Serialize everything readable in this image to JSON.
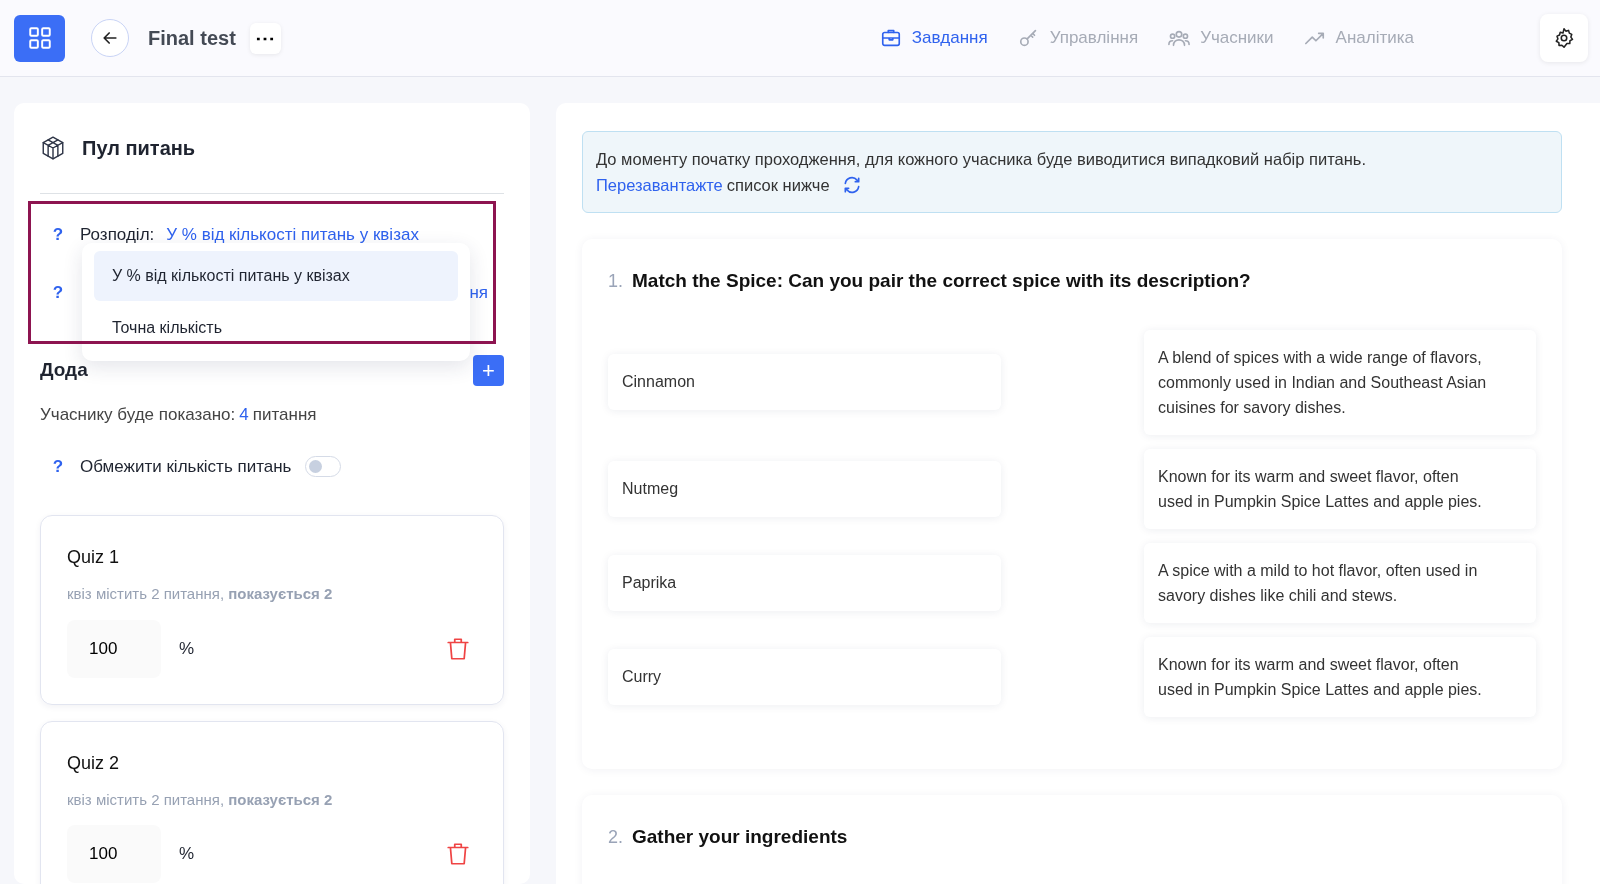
{
  "header": {
    "title": "Final test",
    "more_button": "⋯",
    "nav": [
      {
        "label": "Завдання",
        "selected": true
      },
      {
        "label": "Управління",
        "selected": false
      },
      {
        "label": "Учасники",
        "selected": false
      },
      {
        "label": "Аналітика",
        "selected": false
      }
    ]
  },
  "pool": {
    "title": "Пул питань",
    "distribution": {
      "help": "?",
      "label": "Розподіл:",
      "value": "У % від кількості питань у квізах"
    },
    "second_row": {
      "help": "?",
      "value": "ня"
    },
    "dropdown": {
      "options": [
        {
          "label": "У % від кількості питань у квізах",
          "selected": true
        },
        {
          "label": "Точна кількість",
          "selected": false
        }
      ]
    },
    "quizzes_heading": "Дода",
    "add_button": "+",
    "shown": {
      "prefix": "Учаснику буде показано:",
      "count": "4",
      "suffix": "питання"
    },
    "limit": {
      "help": "?",
      "label": "Обмежити кількість питань",
      "on": false
    },
    "quizzes": [
      {
        "title": "Quiz 1",
        "info": "квіз містить 2 питання, **показується 2**",
        "value": "100",
        "unit": "%"
      },
      {
        "title": "Quiz 2",
        "info": "квіз містить 2 питання, **показується 2**",
        "value": "100",
        "unit": "%"
      }
    ]
  },
  "info_alert": {
    "text": "До моменту початку проходження, для кожного учасника буде виводитися випадковий набір питань.",
    "link": "Перезавантажте",
    "after": "список нижче"
  },
  "questions": [
    {
      "number": "1.",
      "title": "Match the Spice: Can you pair the correct spice with its description?",
      "pairs": [
        {
          "left": "Cinnamon",
          "right": "A blend of spices with a wide range of flavors, commonly used in Indian and Southeast Asian cuisines for savory dishes."
        },
        {
          "left": "Nutmeg",
          "right": "Known for its warm and sweet flavor, often used in Pumpkin Spice Lattes and apple pies."
        },
        {
          "left": "Paprika",
          "right": "A spice with a mild to hot flavor, often used in savory dishes like chili and stews."
        },
        {
          "left": "Curry",
          "right": "Known for its warm and sweet flavor, often used in Pumpkin Spice Lattes and apple pies."
        }
      ]
    },
    {
      "number": "2.",
      "title": "Gather your ingredients"
    }
  ]
}
